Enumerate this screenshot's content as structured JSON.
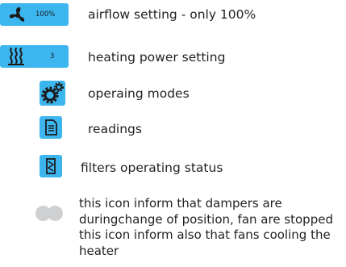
{
  "colors": {
    "accent": "#3db6f0",
    "icon_dark": "#1a1a1a",
    "status_dot": "#cfd0d2",
    "text": "#231f20"
  },
  "legend": {
    "airflow": {
      "icon": "fan-icon",
      "badge_value": "100%",
      "label": "airflow setting - only 100%"
    },
    "heating": {
      "icon": "heater-icon",
      "badge_value": "3",
      "label": "heating power setting"
    },
    "modes": {
      "icon": "gears-icon",
      "label": "operaing modes"
    },
    "readings": {
      "icon": "document-icon",
      "label": "readings"
    },
    "filters": {
      "icon": "filter-icon",
      "label": "filters operating status"
    },
    "dampers": {
      "icon": "dampers-status-icon",
      "lines": [
        "this icon inform that dampers are",
        "duringchange of position, fan are stopped",
        "this icon inform also that fans cooling the",
        "heater"
      ]
    }
  }
}
